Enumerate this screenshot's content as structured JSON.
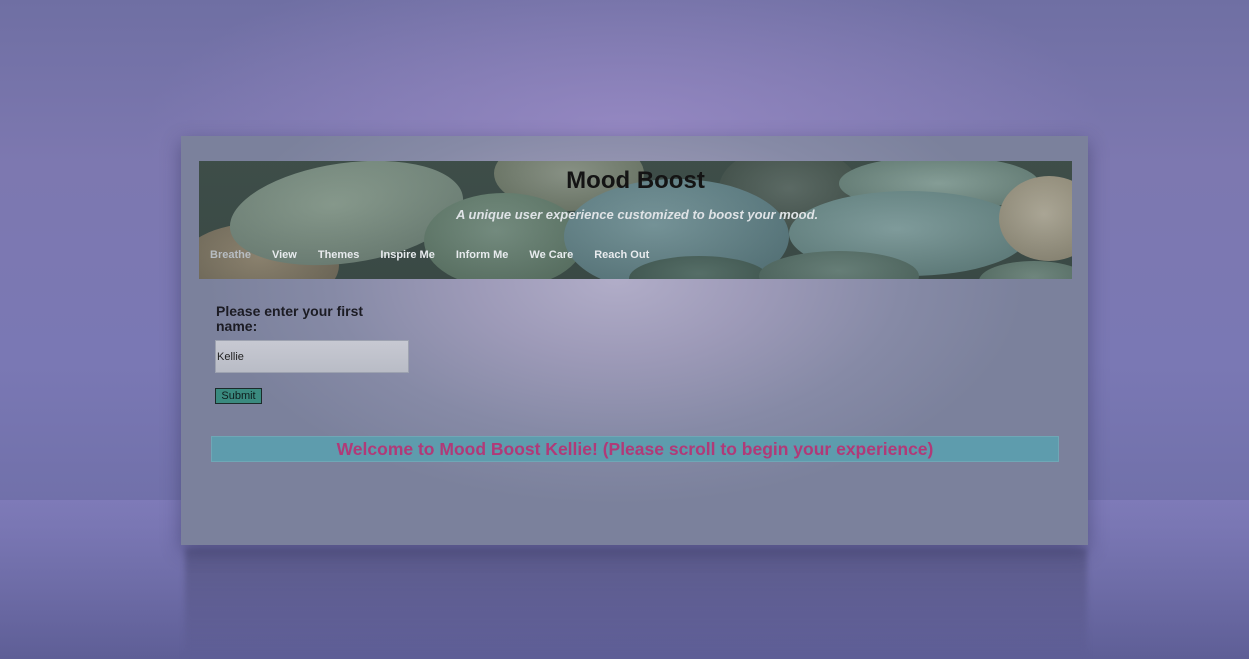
{
  "site": {
    "title": "Mood Boost",
    "tagline": "A unique user experience customized to boost your mood."
  },
  "nav": {
    "items": [
      "Breathe",
      "View",
      "Themes",
      "Inspire Me",
      "Inform Me",
      "We Care",
      "Reach Out"
    ],
    "active": "Breathe"
  },
  "form": {
    "label": "Please enter your first name:",
    "name_value": "Kellie",
    "submit_label": "Submit"
  },
  "welcome": {
    "message": "Welcome to Mood Boost Kellie! (Please scroll to begin your experience)"
  },
  "colors": {
    "welcome_bar": "#5e9cad",
    "welcome_text": "#b03a78",
    "submit_button": "#3a8a7f",
    "page_background": "#7a78b4"
  }
}
